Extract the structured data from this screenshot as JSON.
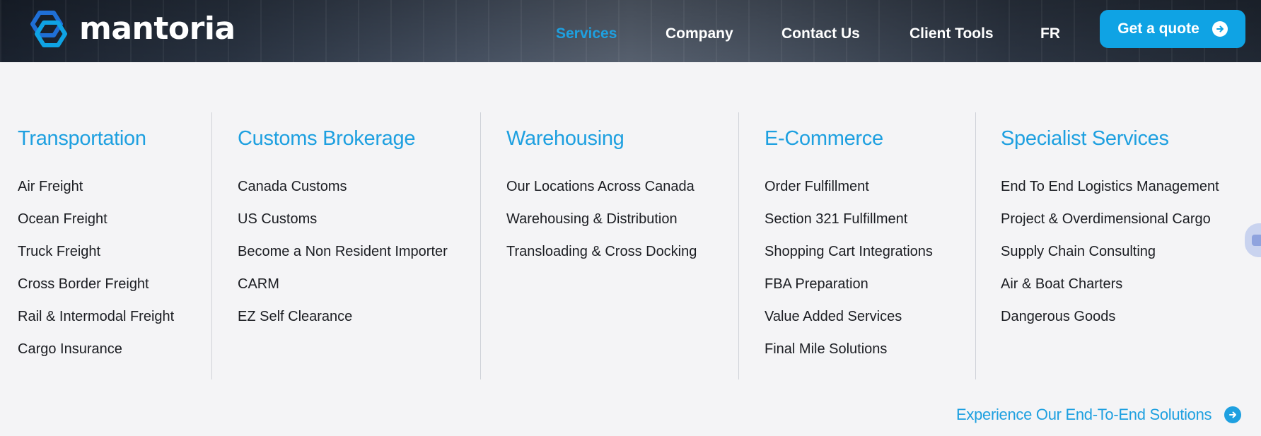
{
  "brand": {
    "name": "mantoria"
  },
  "nav": {
    "items": [
      {
        "label": "Services",
        "active": true
      },
      {
        "label": "Company"
      },
      {
        "label": "Contact Us"
      },
      {
        "label": "Client Tools"
      },
      {
        "label": "FR"
      }
    ],
    "quote_label": "Get a quote",
    "quote_icon": "arrow-right-circle-icon"
  },
  "menu": {
    "columns": [
      {
        "title": "Transportation",
        "items": [
          "Air Freight",
          "Ocean Freight",
          "Truck Freight",
          "Cross Border Freight",
          "Rail & Intermodal Freight",
          "Cargo Insurance"
        ]
      },
      {
        "title": "Customs Brokerage",
        "items": [
          "Canada Customs",
          "US Customs",
          "Become a Non Resident Importer",
          "CARM",
          "EZ Self Clearance"
        ]
      },
      {
        "title": "Warehousing",
        "items": [
          "Our Locations Across Canada",
          "Warehousing & Distribution",
          "Transloading & Cross Docking"
        ]
      },
      {
        "title": "E-Commerce",
        "items": [
          "Order Fulfillment",
          "Section 321 Fulfillment",
          "Shopping Cart Integrations",
          "FBA Preparation",
          "Value Added Services",
          "Final Mile Solutions"
        ]
      },
      {
        "title": "Specialist Services",
        "items": [
          "End To End Logistics Management",
          "Project & Overdimensional Cargo",
          "Supply Chain Consulting",
          "Air & Boat Charters",
          "Dangerous Goods"
        ]
      }
    ],
    "footer_link": "Experience Our End-To-End Solutions"
  },
  "colors": {
    "accent": "#1ea0e0",
    "button": "#0fa3e4",
    "text": "#1b1d22",
    "panel": "#f4f4f6"
  }
}
